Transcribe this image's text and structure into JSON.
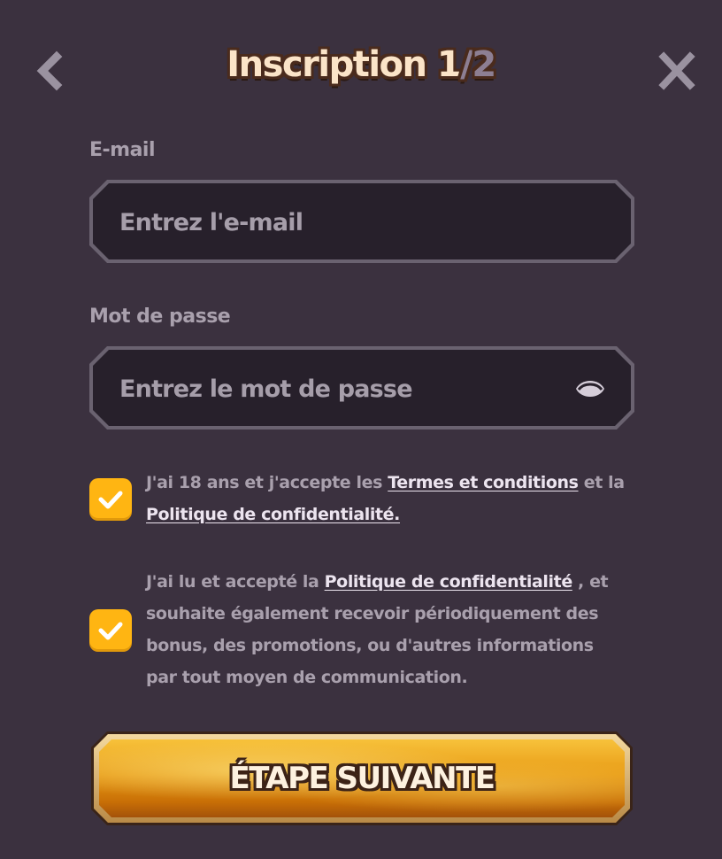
{
  "header": {
    "title_main": "Inscription 1",
    "title_sep": "/",
    "title_total": "2",
    "back_icon": "chevron-left-icon",
    "close_icon": "close-icon"
  },
  "email": {
    "label": "E-mail",
    "placeholder": "Entrez l'e-mail",
    "value": ""
  },
  "password": {
    "label": "Mot de passe",
    "placeholder": "Entrez le mot de passe",
    "value": "",
    "toggle_icon": "eye-icon"
  },
  "consent_terms": {
    "checked": true,
    "text_before": "J'ai 18 ans et j'accepte les ",
    "link_terms": "Termes et conditions",
    "text_mid": " et la ",
    "link_privacy": "Politique de confidentialité."
  },
  "consent_marketing": {
    "checked": true,
    "text_before": "J'ai lu et accepté la ",
    "link_privacy": "Politique de confidentialité",
    "text_after": " , et souhaite également recevoir périodiquement des bonus, des promotions, ou d'autres informations par tout moyen de communication."
  },
  "next_button": {
    "label": "ÉTAPE SUIVANTE"
  },
  "colors": {
    "background": "#3b313f",
    "checkbox": "#ffb512",
    "title_fill": "#fbe4c8",
    "title_outline": "#4a2b1d",
    "button_gold": "#e89a14"
  }
}
